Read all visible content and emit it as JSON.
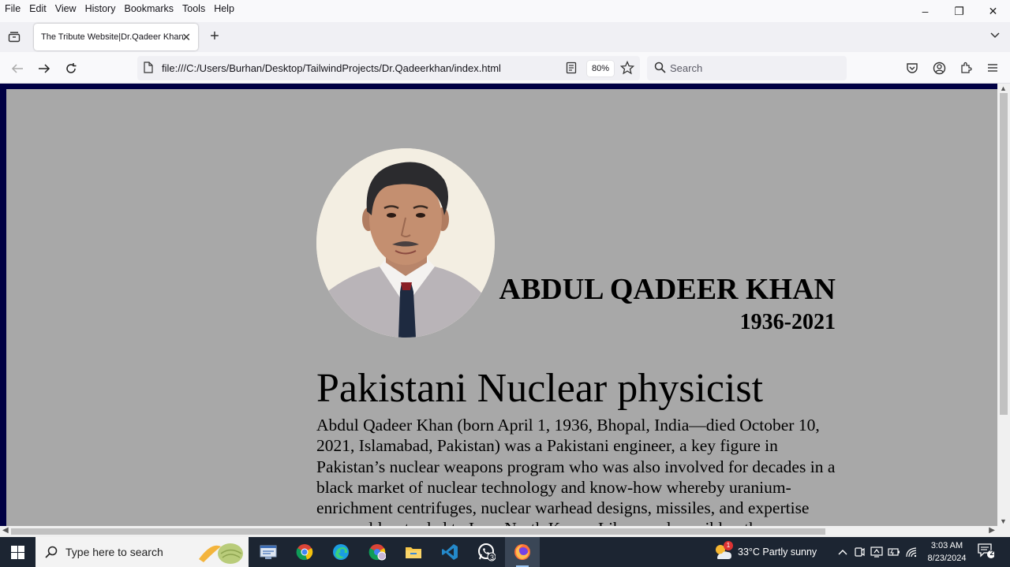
{
  "menu": [
    "File",
    "Edit",
    "View",
    "History",
    "Bookmarks",
    "Tools",
    "Help"
  ],
  "window_controls": {
    "minimize": "–",
    "restore": "❐",
    "close": "✕"
  },
  "tab": {
    "title": "The Tribute Website|Dr.Qadeer Khan",
    "close": "✕"
  },
  "new_tab": "+",
  "nav": {
    "url": "file:///C:/Users/Burhan/Desktop/TailwindProjects/Dr.Qadeerkhan/index.html",
    "zoom": "80%",
    "search_placeholder": "Search"
  },
  "page": {
    "name": "ABDUL QADEER KHAN",
    "years": "1936-2021",
    "subtitle": "Pakistani Nuclear physicist",
    "bio": "Abdul Qadeer Khan (born April 1, 1936, Bhopal, India—died October 10, 2021, Islamabad, Pakistan) was a Pakistani engineer, a key figure in Pakistan’s nuclear weapons program who was also involved for decades in a black market of nuclear technology and know-how whereby uranium-enrichment centrifuges, nuclear warhead designs, missiles, and expertise were sold or traded to Iran, North Korea, Libya, and possibly other countries."
  },
  "taskbar": {
    "search_placeholder": "Type here to search",
    "whatsapp_badge": "3",
    "weather_badge": "1",
    "weather": "33°C  Partly sunny",
    "time": "3:03 AM",
    "date": "8/23/2024",
    "notifications": "2"
  },
  "colors": {
    "page_bg": "#a8a8a8",
    "frame": "#000044",
    "taskbar": "#1c2532"
  }
}
